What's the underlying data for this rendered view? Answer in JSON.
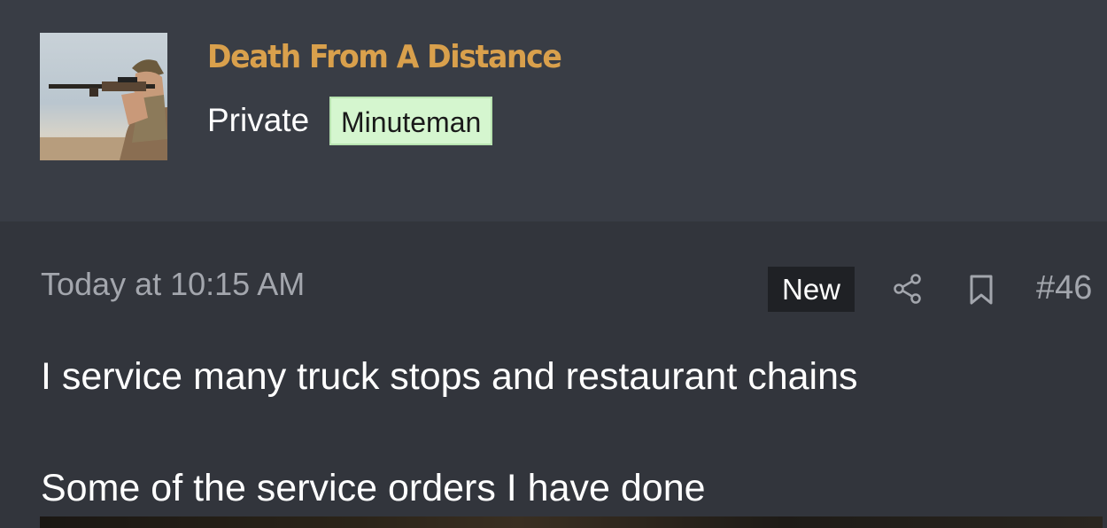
{
  "author": {
    "name": "Death From A Distance",
    "rank": "Private",
    "badge": "Minuteman",
    "avatar_icon": "rifleman-avatar"
  },
  "post": {
    "timestamp": "Today at 10:15 AM",
    "new_label": "New",
    "number": "#46",
    "lines": [
      "I service many truck stops and restaurant chains",
      "Some of the service orders I have done"
    ]
  },
  "colors": {
    "username": "#d9a04c",
    "header_bg": "#393d45",
    "post_bg": "#32353c",
    "badge_bg": "#d5f6cf",
    "muted_text": "#a3a6ad"
  },
  "icons": [
    "share-icon",
    "bookmark-icon"
  ]
}
